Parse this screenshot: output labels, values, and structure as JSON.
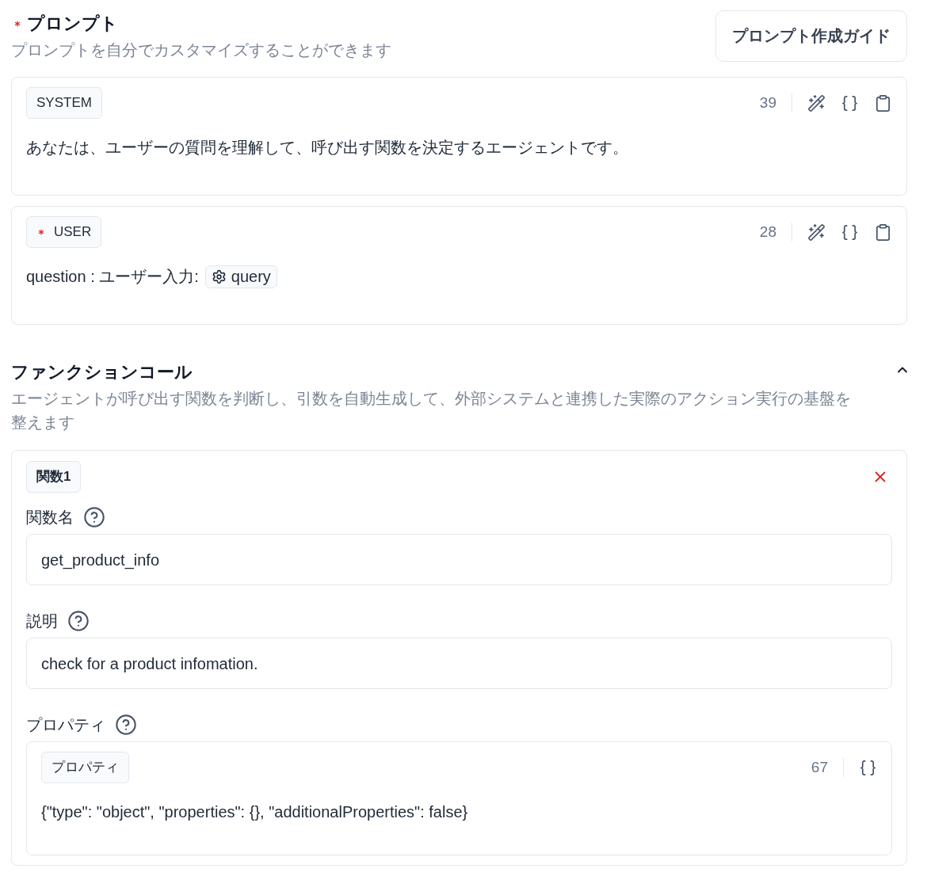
{
  "prompt": {
    "required": true,
    "title": "プロンプト",
    "subtitle": "プロンプトを自分でカスタマイズすることができます",
    "guide_button": "プロンプト作成ガイド"
  },
  "messages": [
    {
      "role": "SYSTEM",
      "required": false,
      "count": "39",
      "content": [
        {
          "kind": "text",
          "text": "あなたは、ユーザーの質問を理解して、呼び出す関数を決定するエージェントです。"
        }
      ]
    },
    {
      "role": "USER",
      "required": true,
      "count": "28",
      "content": [
        {
          "kind": "text",
          "text": "question : ユーザー入力:"
        },
        {
          "kind": "variable",
          "text": "query"
        }
      ]
    }
  ],
  "function_call": {
    "title": "ファンクションコール",
    "expanded": true,
    "description": "エージェントが呼び出す関数を判断し、引数を自動生成して、外部システムと連携した実際のアクション実行の基盤を整えます",
    "functions": [
      {
        "tag": "関数1",
        "fields": [
          {
            "kind": "input",
            "label": "関数名",
            "value": "get_product_info"
          },
          {
            "kind": "input",
            "label": "説明",
            "value": "check for a product infomation."
          },
          {
            "kind": "json",
            "label": "プロパティ",
            "tag": "プロパティ",
            "count": "67",
            "value": "{\"type\": \"object\", \"properties\": {}, \"additionalProperties\": false}"
          }
        ]
      }
    ]
  }
}
